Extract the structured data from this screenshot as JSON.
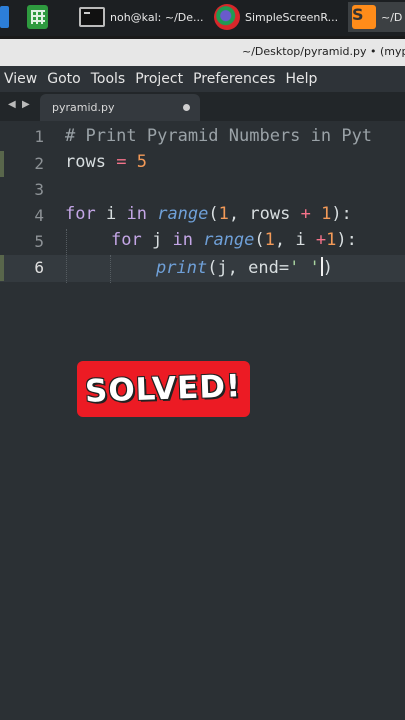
{
  "taskbar": {
    "items": [
      {
        "icon": "file-manager-icon",
        "label": ""
      },
      {
        "icon": "spreadsheet-icon",
        "label": ""
      },
      {
        "icon": "terminal-icon",
        "label": "noh@kal: ~/De..."
      },
      {
        "icon": "simplescreenrecorder-icon",
        "label": "SimpleScreenR..."
      },
      {
        "icon": "sublime-text-icon",
        "label": "~/D"
      }
    ]
  },
  "window": {
    "title": "~/Desktop/pyramid.py • (mypor"
  },
  "menu": [
    "View",
    "Goto",
    "Tools",
    "Project",
    "Preferences",
    "Help"
  ],
  "tabbar": {
    "nav_left": "◀",
    "nav_right": "▶",
    "tab_label": "pyramid.py"
  },
  "editor": {
    "line_numbers": [
      "1",
      "2",
      "3",
      "4",
      "5",
      "6"
    ],
    "current_line": "6",
    "lines": {
      "l1_comment": "# Print Pyramid Numbers in Pyt",
      "l2_var": "rows",
      "l2_eq": "=",
      "l2_val": "5",
      "l4_for": "for",
      "l4_i": "i",
      "l4_in": "in",
      "l4_range": "range",
      "l4_args_a": "(",
      "l4_one": "1",
      "l4_args_b": ", rows",
      "l4_plus": "+",
      "l4_one_b": "1",
      "l4_close": "):",
      "l5_for": "for",
      "l5_j": "j",
      "l5_in": "in",
      "l5_range": "range",
      "l5_args_a": "(",
      "l5_one": "1",
      "l5_args_b": ", i",
      "l5_plus": "+",
      "l5_one_b": "1",
      "l5_close": "):",
      "l6_print": "print",
      "l6_args": "(j, end=",
      "l6_str": "' '",
      "l6_close": ")"
    }
  },
  "badge": {
    "text": "SOLVED!",
    "color": "#ec1b24"
  }
}
